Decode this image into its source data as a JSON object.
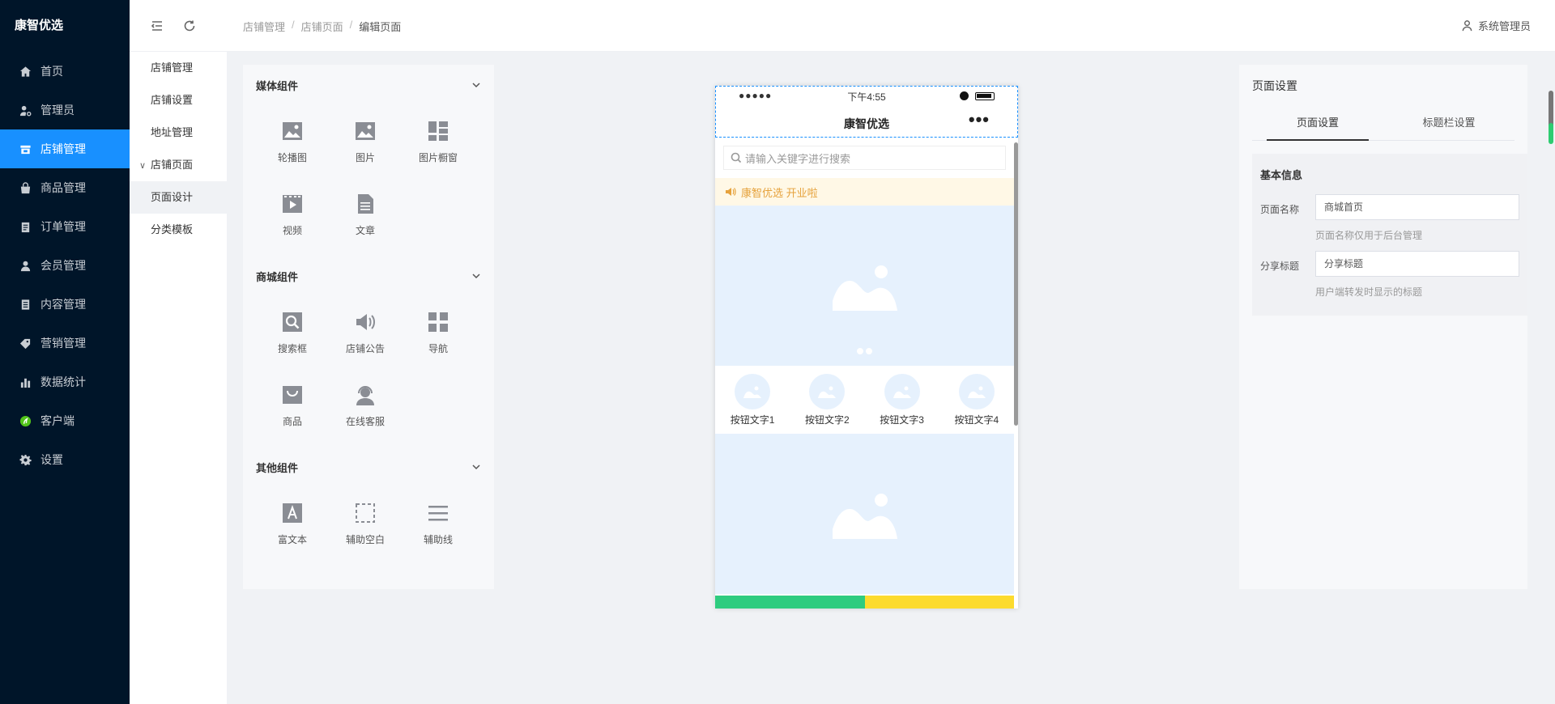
{
  "app": {
    "logo": "康智优选"
  },
  "sidebar": {
    "items": [
      {
        "label": "首页",
        "icon": "home-icon",
        "active": false
      },
      {
        "label": "管理员",
        "icon": "user-gear-icon",
        "active": false
      },
      {
        "label": "店铺管理",
        "icon": "store-icon",
        "active": true
      },
      {
        "label": "商品管理",
        "icon": "bag-icon",
        "active": false
      },
      {
        "label": "订单管理",
        "icon": "clipboard-icon",
        "active": false
      },
      {
        "label": "会员管理",
        "icon": "member-icon",
        "active": false
      },
      {
        "label": "内容管理",
        "icon": "document-icon",
        "active": false
      },
      {
        "label": "营销管理",
        "icon": "tag-icon",
        "active": false
      },
      {
        "label": "数据统计",
        "icon": "bar-chart-icon",
        "active": false
      },
      {
        "label": "客户端",
        "icon": "client-icon",
        "active": false
      },
      {
        "label": "设置",
        "icon": "gear-icon",
        "active": false
      }
    ]
  },
  "header": {
    "breadcrumb": [
      "店铺管理",
      "店铺页面",
      "编辑页面"
    ],
    "breadcrumb_sep": "/",
    "user": "系统管理员"
  },
  "subnav": {
    "items": [
      {
        "label": "店铺管理"
      },
      {
        "label": "店铺设置"
      },
      {
        "label": "地址管理"
      },
      {
        "label": "店铺页面",
        "group": true,
        "arrow": "∨"
      },
      {
        "label": "页面设计",
        "active": true
      },
      {
        "label": "分类模板"
      }
    ]
  },
  "components": {
    "groups": [
      {
        "title": "媒体组件",
        "items": [
          {
            "label": "轮播图",
            "icon": "carousel-icon"
          },
          {
            "label": "图片",
            "icon": "image-icon"
          },
          {
            "label": "图片橱窗",
            "icon": "image-window-icon"
          },
          {
            "label": "视频",
            "icon": "video-icon"
          },
          {
            "label": "文章",
            "icon": "article-icon"
          }
        ]
      },
      {
        "title": "商城组件",
        "items": [
          {
            "label": "搜索框",
            "icon": "search-box-icon"
          },
          {
            "label": "店铺公告",
            "icon": "announcement-icon"
          },
          {
            "label": "导航",
            "icon": "navigation-icon"
          },
          {
            "label": "商品",
            "icon": "product-icon"
          },
          {
            "label": "在线客服",
            "icon": "customer-service-icon"
          }
        ]
      },
      {
        "title": "其他组件",
        "items": [
          {
            "label": "富文本",
            "icon": "rich-text-icon"
          },
          {
            "label": "辅助空白",
            "icon": "blank-space-icon"
          },
          {
            "label": "辅助线",
            "icon": "divider-line-icon"
          }
        ]
      }
    ]
  },
  "phone": {
    "status_signal": "●●●●●",
    "status_time": "下午4:55",
    "title": "康智优选",
    "more": "•••",
    "search_placeholder": "请输入关键字进行搜索",
    "notice": "康智优选 开业啦",
    "nav_buttons": [
      "按钮文字1",
      "按钮文字2",
      "按钮文字3",
      "按钮文字4"
    ],
    "tabbar_colors": [
      "#2ecc7f",
      "#fcdb2e"
    ]
  },
  "settings": {
    "title": "页面设置",
    "tabs": [
      {
        "label": "页面设置",
        "active": true
      },
      {
        "label": "标题栏设置",
        "active": false
      }
    ],
    "section_title": "基本信息",
    "fields": [
      {
        "label": "页面名称",
        "value": "商城首页",
        "hint": "页面名称仅用于后台管理"
      },
      {
        "label": "分享标题",
        "value": "分享标题",
        "hint": "用户端转发时显示的标题"
      }
    ]
  },
  "colors": {
    "sidebar_bg": "#001529",
    "accent": "#1890ff"
  }
}
